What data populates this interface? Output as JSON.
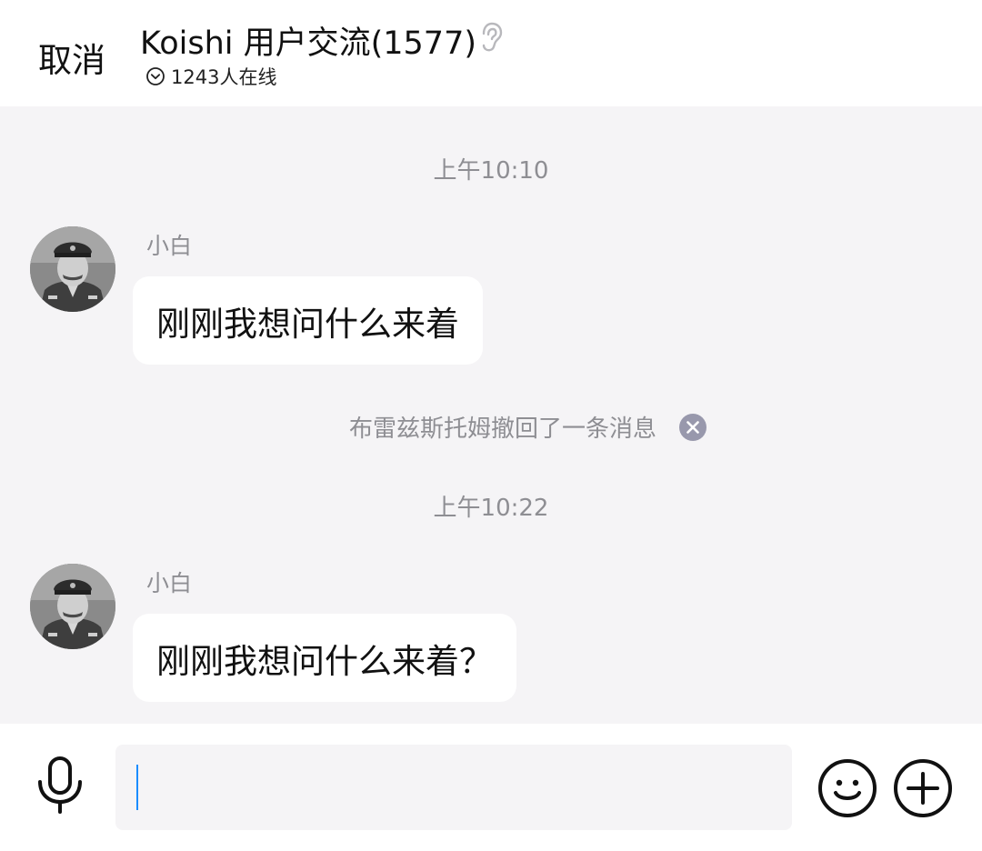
{
  "header": {
    "cancel_label": "取消",
    "title": "Koishi 用户交流(1577)",
    "online_text": "1243人在线",
    "title_icon": "ear-icon",
    "online_icon": "chevron-down-circle-icon"
  },
  "messages": [
    {
      "type": "time",
      "text": "上午10:10"
    },
    {
      "type": "message",
      "sender": "小白",
      "text": "刚刚我想问什么来着"
    },
    {
      "type": "recall",
      "text": "布雷兹斯托姆撤回了一条消息"
    },
    {
      "type": "time",
      "text": "上午10:22"
    },
    {
      "type": "message",
      "sender": "小白",
      "text": "刚刚我想问什么来着？"
    }
  ],
  "input": {
    "value": "",
    "placeholder": "",
    "left_icon": "microphone-icon",
    "right_icons": [
      "emoji-icon",
      "plus-icon"
    ]
  },
  "colors": {
    "chat_background": "#f5f4f6",
    "bubble": "#ffffff",
    "meta_text": "#8e8e93",
    "caret": "#1a8cff",
    "recall_close": "#9898ac"
  }
}
